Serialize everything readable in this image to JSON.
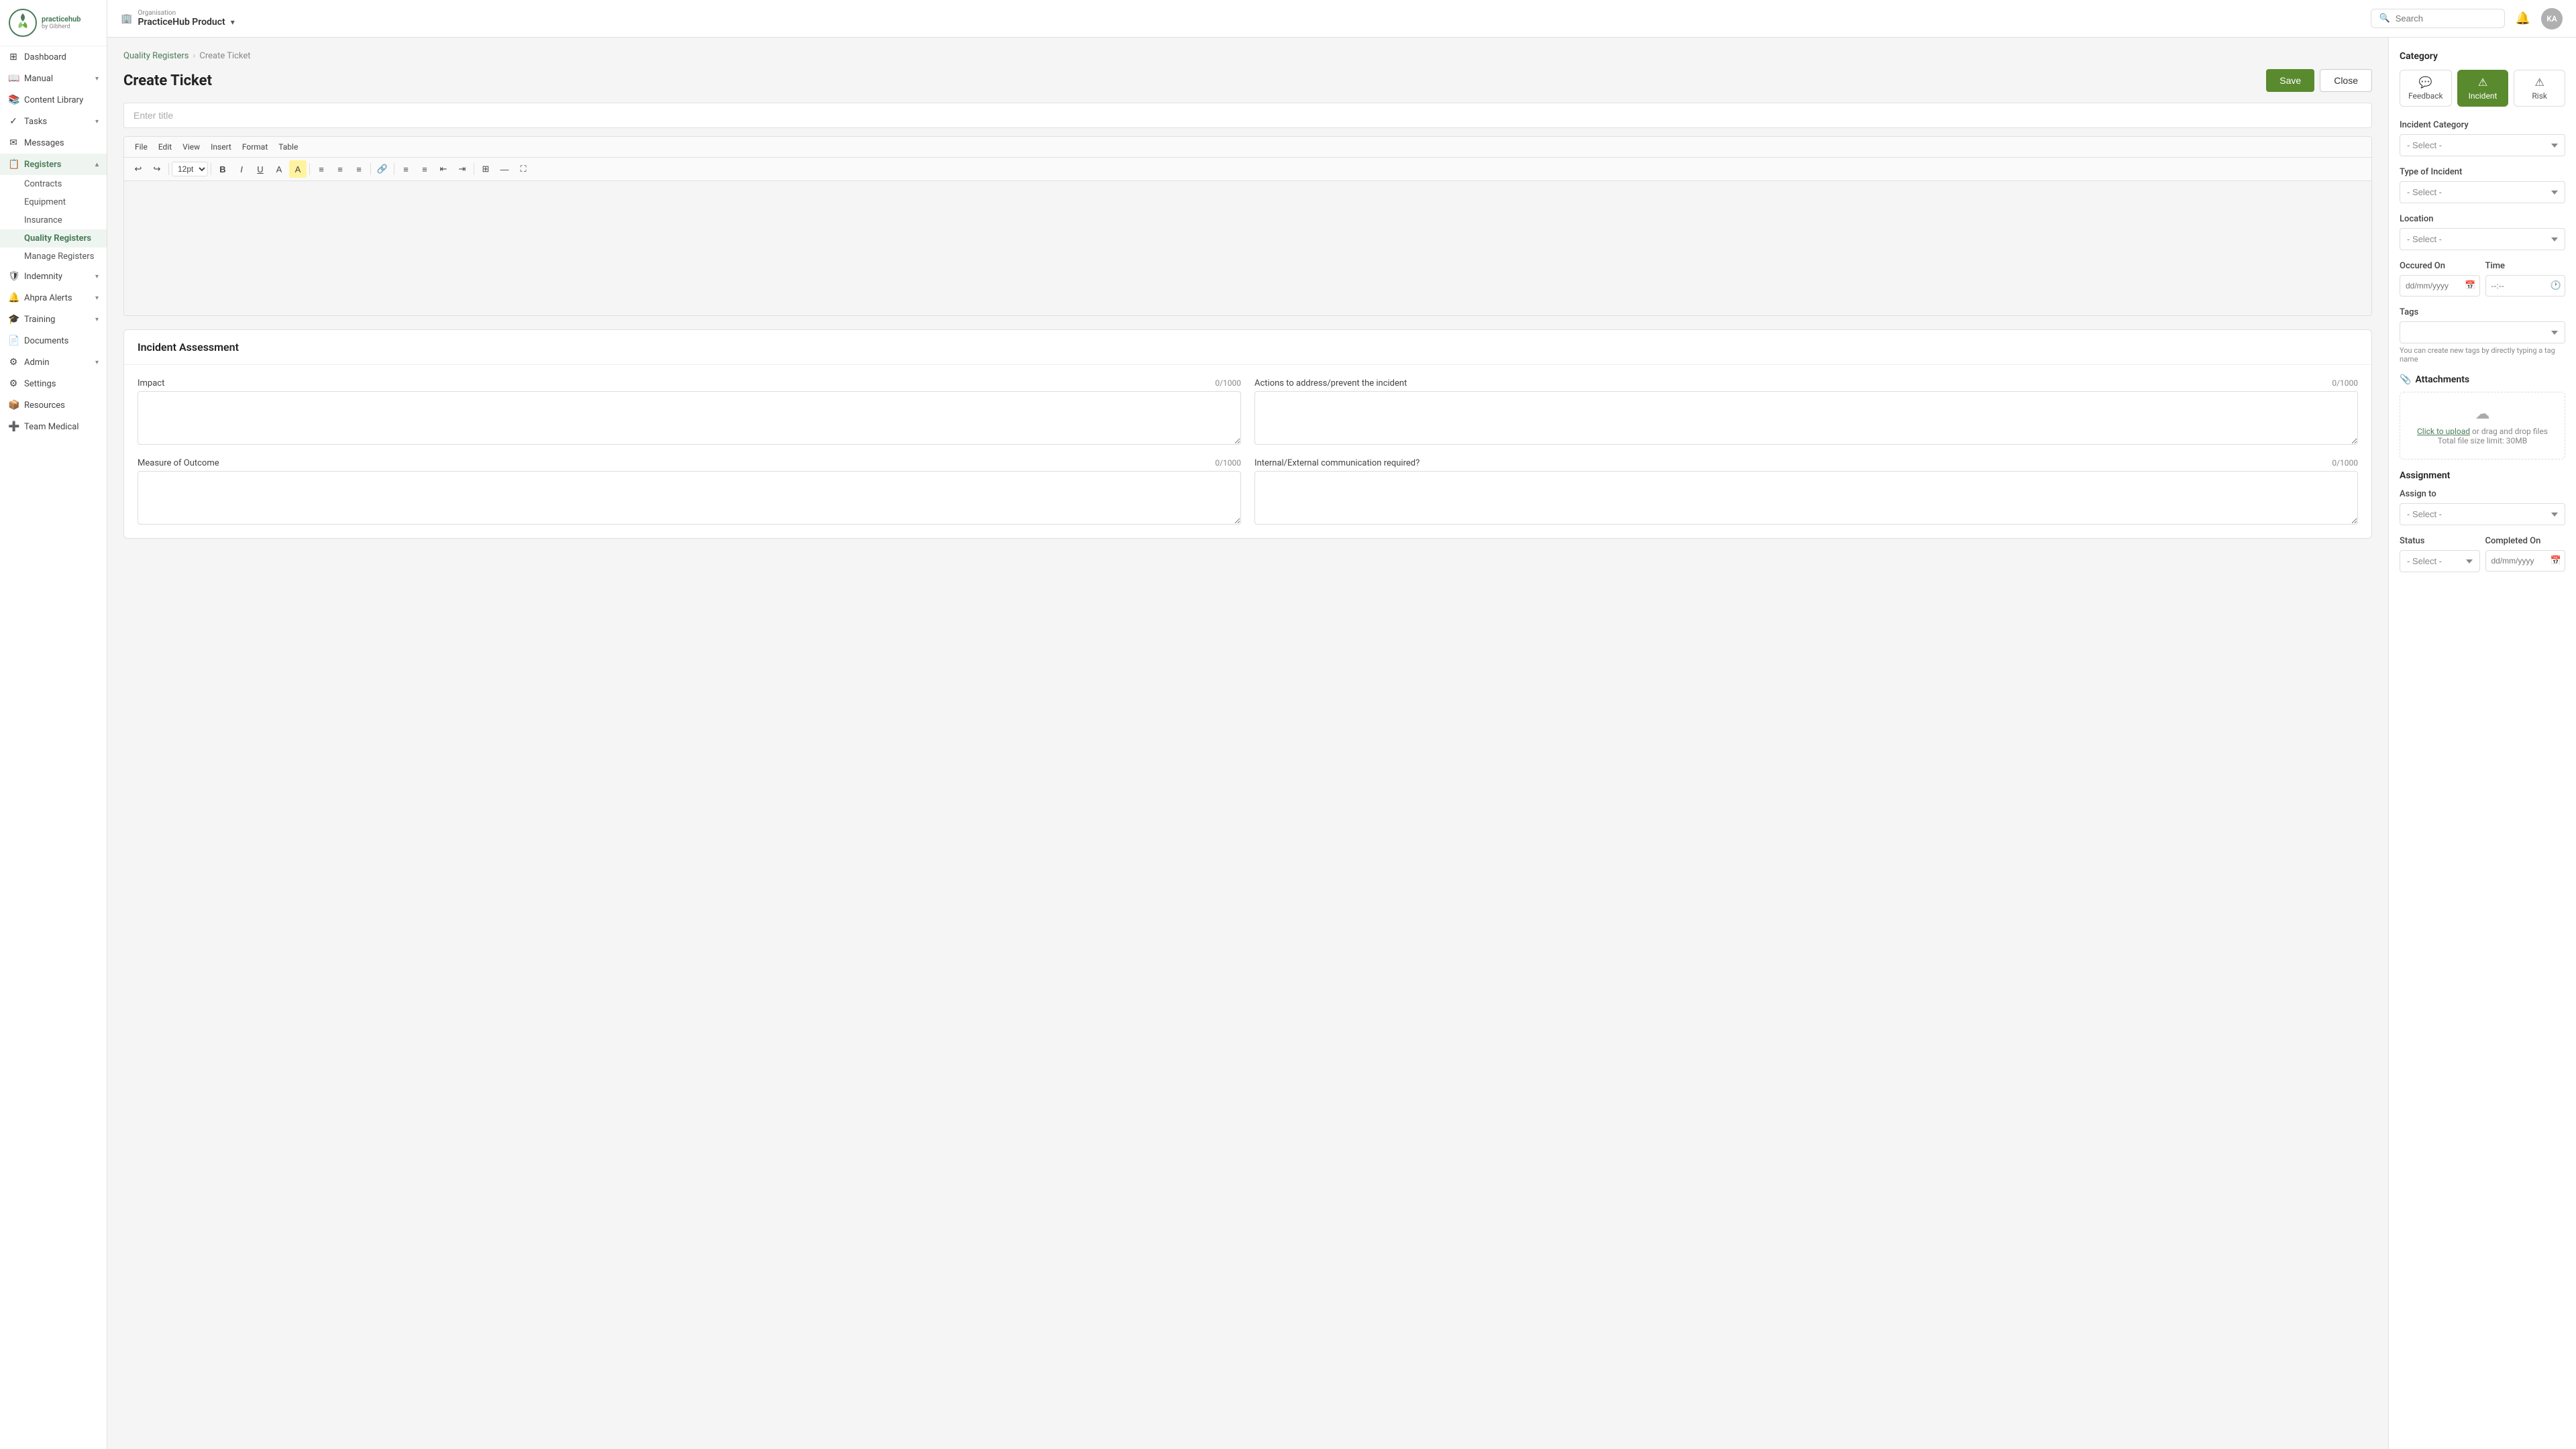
{
  "app": {
    "logo_text": "practicehub",
    "logo_subtitle": "by Gibherd"
  },
  "topbar": {
    "org_label": "Organisation",
    "org_name": "PracticeHub Product",
    "search_placeholder": "Search",
    "avatar_initials": "KA"
  },
  "sidebar": {
    "items": [
      {
        "id": "dashboard",
        "label": "Dashboard",
        "icon": "⊞",
        "has_children": false
      },
      {
        "id": "manual",
        "label": "Manual",
        "icon": "📖",
        "has_children": true
      },
      {
        "id": "content-library",
        "label": "Content Library",
        "icon": "📚",
        "has_children": false
      },
      {
        "id": "tasks",
        "label": "Tasks",
        "icon": "✓",
        "has_children": true
      },
      {
        "id": "messages",
        "label": "Messages",
        "icon": "✉",
        "has_children": false
      },
      {
        "id": "registers",
        "label": "Registers",
        "icon": "📋",
        "has_children": true,
        "active": true
      },
      {
        "id": "indemnity",
        "label": "Indemnity",
        "icon": "🛡",
        "has_children": true
      },
      {
        "id": "ahpra-alerts",
        "label": "Ahpra Alerts",
        "icon": "🔔",
        "has_children": true
      },
      {
        "id": "training",
        "label": "Training",
        "icon": "🎓",
        "has_children": true
      },
      {
        "id": "documents",
        "label": "Documents",
        "icon": "📄",
        "has_children": false
      },
      {
        "id": "admin",
        "label": "Admin",
        "icon": "⚙",
        "has_children": true
      },
      {
        "id": "settings",
        "label": "Settings",
        "icon": "⚙",
        "has_children": false
      },
      {
        "id": "resources",
        "label": "Resources",
        "icon": "📦",
        "has_children": false
      },
      {
        "id": "team-medical",
        "label": "Team Medical",
        "icon": "➕",
        "has_children": false
      }
    ],
    "registers_children": [
      {
        "id": "contracts",
        "label": "Contracts"
      },
      {
        "id": "equipment",
        "label": "Equipment"
      },
      {
        "id": "insurance",
        "label": "Insurance"
      },
      {
        "id": "quality-registers",
        "label": "Quality Registers",
        "active": true
      },
      {
        "id": "manage-registers",
        "label": "Manage Registers"
      }
    ]
  },
  "breadcrumb": {
    "parent": "Quality Registers",
    "current": "Create Ticket"
  },
  "page": {
    "title": "Create Ticket",
    "save_btn": "Save",
    "close_btn": "Close"
  },
  "editor": {
    "title_placeholder": "Enter title",
    "menu_items": [
      "File",
      "Edit",
      "View",
      "Insert",
      "Format",
      "Table"
    ],
    "font_size": "12pt"
  },
  "incident_assessment": {
    "section_title": "Incident Assessment",
    "fields": [
      {
        "id": "impact",
        "label": "Impact",
        "char_count": "0/1000"
      },
      {
        "id": "actions",
        "label": "Actions to address/prevent the incident",
        "char_count": "0/1000"
      },
      {
        "id": "measure",
        "label": "Measure of Outcome",
        "char_count": "0/1000"
      },
      {
        "id": "comms",
        "label": "Internal/External communication required?",
        "char_count": "0/1000"
      }
    ]
  },
  "right_panel": {
    "category_label": "Category",
    "tabs": [
      {
        "id": "feedback",
        "label": "Feedback",
        "icon": "💬"
      },
      {
        "id": "incident",
        "label": "Incident",
        "icon": "⚠",
        "active": true
      },
      {
        "id": "risk",
        "label": "Risk",
        "icon": "⚠"
      }
    ],
    "incident_category_label": "Incident Category",
    "incident_category_placeholder": "- Select -",
    "type_of_incident_label": "Type of Incident",
    "type_of_incident_placeholder": "- Select -",
    "location_label": "Location",
    "location_placeholder": "- Select -",
    "occurred_on_label": "Occured On",
    "occurred_on_placeholder": "dd/mm/yyyy",
    "time_label": "Time",
    "time_placeholder": "--:--",
    "tags_label": "Tags",
    "tags_placeholder": "",
    "tags_hint": "You can create new tags by directly typing a tag name",
    "attachments_label": "Attachments",
    "upload_text_link": "Click to upload",
    "upload_text_rest": " or drag and drop files",
    "upload_size": "Total file size limit: 30MB",
    "assignment_label": "Assignment",
    "assign_to_label": "Assign to",
    "assign_to_placeholder": "- Select -",
    "status_label": "Status",
    "completed_on_label": "Completed On"
  }
}
